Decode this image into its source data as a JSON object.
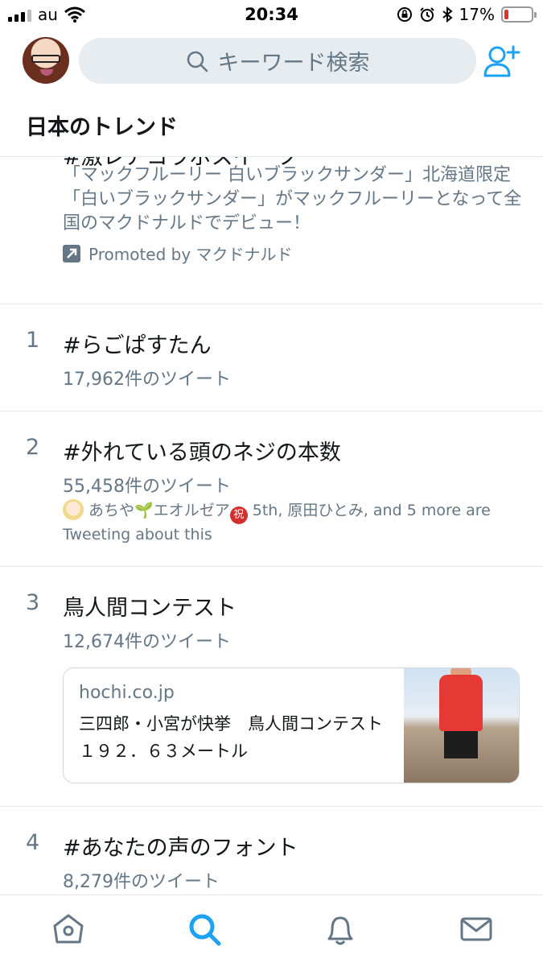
{
  "status_bar": {
    "carrier": "au",
    "time": "20:34",
    "battery_percent": "17%",
    "battery_level": 0.17,
    "icons": [
      "signal-icon",
      "wifi-icon",
      "orientation-lock-icon",
      "alarm-icon",
      "bluetooth-icon",
      "battery-icon"
    ]
  },
  "header": {
    "search_placeholder": "キーワード検索",
    "icons": [
      "avatar",
      "search-icon",
      "add-user-icon"
    ]
  },
  "section_title": "日本のトレンド",
  "promoted_trend": {
    "hashtag": "#激レアコラボスイーツ",
    "description": "「マックフルーリー 白いブラックサンダー」北海道限定「白いブラックサンダー」がマックフルーリーとなって全国のマクドナルドでデビュー！",
    "promoted_by": "Promoted by マクドナルド"
  },
  "trends": [
    {
      "rank": "1",
      "name": "#らごぱすたん",
      "count": "17,962件のツイート"
    },
    {
      "rank": "2",
      "name": "#外れている頭のネジの本数",
      "count": "55,458件のツイート",
      "tweeters_a": "あちや",
      "tweeters_b": "エオルゼア",
      "tweeters_c": "5th, 原田ひとみ, and 5 more are Tweeting about this"
    },
    {
      "rank": "3",
      "name": "鳥人間コンテスト",
      "count": "12,674件のツイート",
      "card": {
        "domain": "hochi.co.jp",
        "title": "三四郎・小宮が快挙　鳥人間コンテスト１９２．６３メートル"
      }
    },
    {
      "rank": "4",
      "name": "#あなたの声のフォント",
      "count": "8,279件のツイート"
    }
  ],
  "tab_bar": {
    "tabs": [
      "home-icon",
      "search-icon",
      "notifications-icon",
      "messages-icon"
    ],
    "active": "search-icon",
    "accent_color": "#1da1f2",
    "inactive_color": "#657786"
  }
}
